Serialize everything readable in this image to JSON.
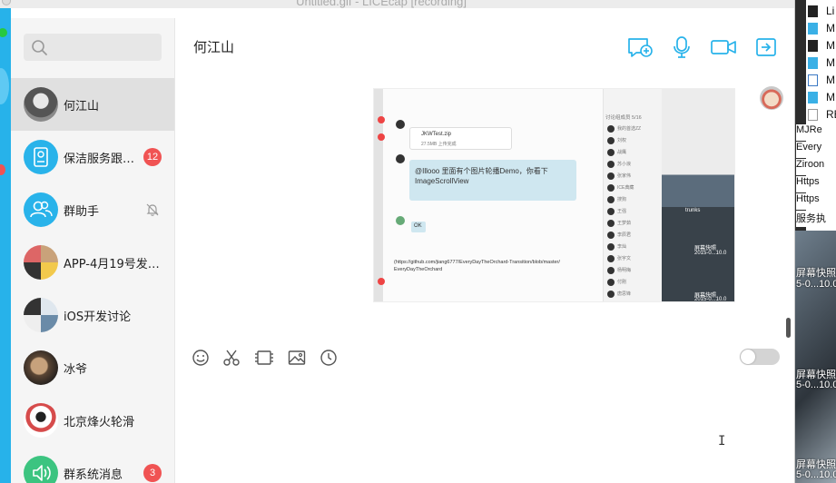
{
  "window": {
    "title": "Untitled.gif - LICEcap [recording]"
  },
  "search": {
    "placeholder": ""
  },
  "chat_list": [
    {
      "name": "何江山",
      "badge": ""
    },
    {
      "name": "保洁服务跟…",
      "badge": "12"
    },
    {
      "name": "群助手",
      "badge": ""
    },
    {
      "name": "APP-4月19号发…",
      "badge": ""
    },
    {
      "name": "iOS开发讨论",
      "badge": ""
    },
    {
      "name": "冰爷",
      "badge": ""
    },
    {
      "name": "北京烽火轮滑",
      "badge": ""
    },
    {
      "name": "群系统消息",
      "badge": "3"
    }
  ],
  "header": {
    "title": "何江山",
    "icons": [
      "new-chat-icon",
      "microphone-icon",
      "video-call-icon",
      "share-icon"
    ]
  },
  "screenshot_message": {
    "file_name": "JKWTest.zip",
    "file_meta": "27.5MB  上传完成",
    "message_text": "@Illooo 里面有个图片轮播Demo，你看下 ImageScrollView",
    "reply_text": "OK",
    "link_text": "(https://github.com/jiang6777/EveryDayTheOrchard-Transition/blob/master/ EveryDayTheOrchard",
    "members_header": "讨论组成员 5/16",
    "members": [
      "我的首选ZZ",
      "刘权",
      "战鹰",
      "苏小浪",
      "张家伟",
      "ICE典藏",
      "搜狗",
      "王强",
      "王梦茹",
      "李辰君",
      "李灿",
      "张宇文",
      "杨明梅",
      "付刚",
      "唐思锋"
    ],
    "desktop_labels": [
      "trunks",
      "屏幕快照",
      "2015-0...10.0",
      "屏幕快照",
      "2015-0...10.0"
    ]
  },
  "composer": {
    "tools": [
      "emoji-icon",
      "scissors-icon",
      "video-clip-icon",
      "image-icon",
      "history-icon"
    ]
  },
  "finder": {
    "rows": [
      "Li",
      "M",
      "M",
      "M",
      "M",
      "M",
      "RE"
    ],
    "desktop_items": [
      "MJRe",
      "Every",
      "Ziroon",
      "Https",
      "Https",
      "服务执"
    ],
    "photo_labels": [
      "屏幕快照",
      "5-0...10.0",
      "屏幕快照",
      "5-0...10.0",
      "屏幕快照",
      "5-0...10.0",
      "屏幕快照"
    ]
  },
  "colors": {
    "accent": "#27b2ea",
    "badge": "#f05353",
    "sidebar_bg": "#f5f5f5",
    "active_row": "#e0e0e0"
  }
}
